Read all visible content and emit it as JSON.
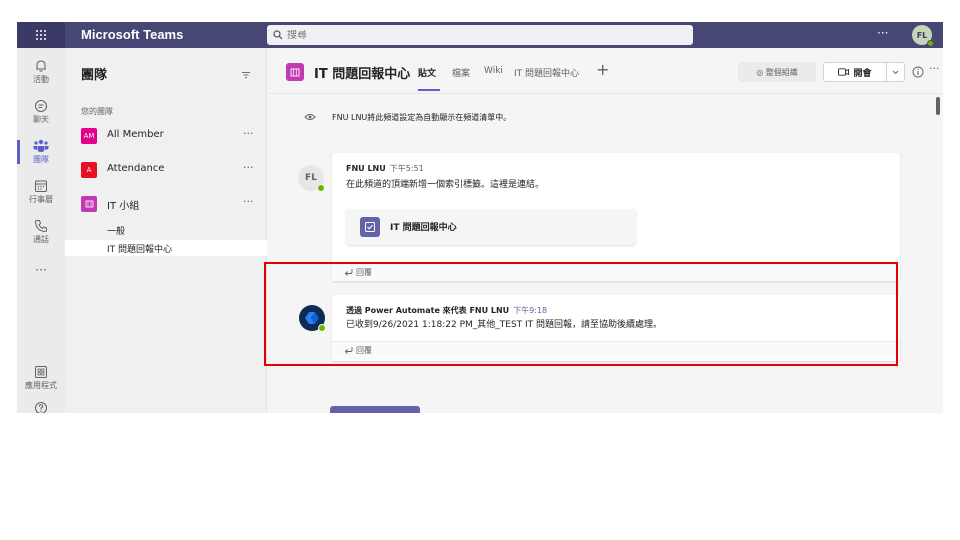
{
  "app": {
    "title": "Microsoft Teams",
    "search_placeholder": "搜尋",
    "more_label": "···",
    "user_initials": "FL"
  },
  "rail": {
    "items": [
      {
        "label": "活動",
        "icon": "bell-icon"
      },
      {
        "label": "聊天",
        "icon": "chat-icon"
      },
      {
        "label": "團隊",
        "icon": "teams-icon"
      },
      {
        "label": "行事曆",
        "icon": "calendar-icon"
      },
      {
        "label": "通話",
        "icon": "phone-icon"
      },
      {
        "label": "···",
        "icon": "more-icon"
      }
    ],
    "bottom": [
      {
        "label": "應用程式",
        "icon": "apps-icon"
      },
      {
        "label": "說明",
        "icon": "help-icon"
      }
    ]
  },
  "teams_panel": {
    "title": "團隊",
    "section": "您的團隊",
    "teams": [
      {
        "badge": "AM",
        "name": "All Member",
        "color": "#e3008c"
      },
      {
        "badge": "A",
        "name": "Attendance",
        "color": "#e81123"
      },
      {
        "badge": "IT",
        "name": "IT 小組",
        "color": "#c239b3"
      }
    ],
    "more_label": "···",
    "channels": [
      "一般",
      "IT 問題回報中心"
    ]
  },
  "channel": {
    "title": "IT 問題回報中心",
    "tabs": [
      "貼文",
      "檔案",
      "Wiki",
      "IT 問題回報中心"
    ],
    "add_tab": "+",
    "team_button": "◎ 整個組織",
    "meet_button": "開會",
    "more_label": "···"
  },
  "feed": {
    "system_message": "FNU LNU將此頻道設定為自動顯示在頻道清單中。",
    "post1": {
      "avatar": "FL",
      "author": "FNU LNU",
      "time": "下午5:51",
      "text": "在此頻道的頂端新增一個索引標籤。這裡是連結。",
      "card_title": "IT 問題回報中心",
      "reply": "回覆"
    },
    "post2": {
      "author": "透過 Power Automate 來代表 FNU LNU",
      "time": "下午9:18",
      "text": "已收到9/26/2021 1:18:22 PM_其他_TEST IT 問題回報，請至協助後續處理。",
      "reply": "回覆"
    }
  },
  "colors": {
    "topbar": "#464775",
    "accent": "#5b5fc7",
    "highlight": "#e80000"
  }
}
